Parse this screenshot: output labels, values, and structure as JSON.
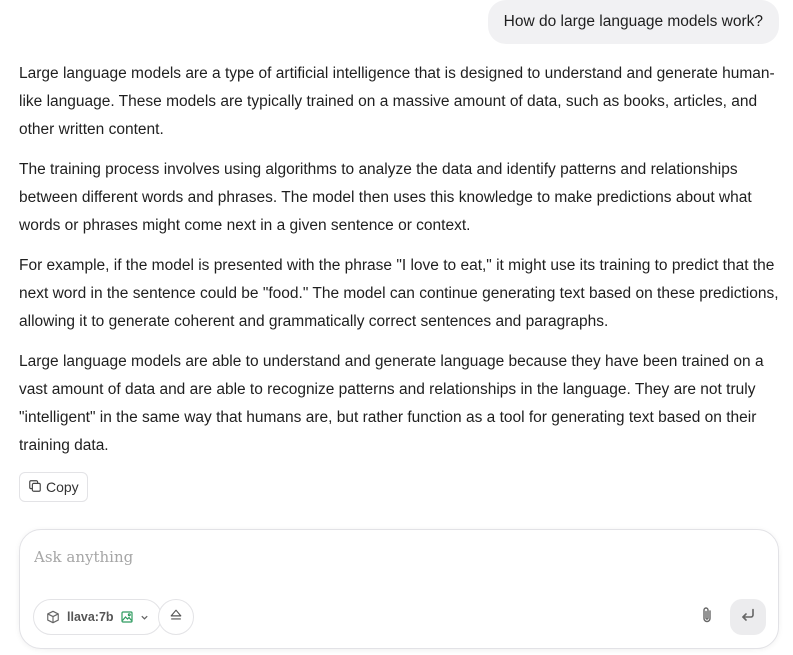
{
  "user_message": "How do large language models work?",
  "answer": {
    "paragraphs": [
      "Large language models are a type of artificial intelligence that is designed to understand and generate human-like language. These models are typically trained on a massive amount of data, such as books, articles, and other written content.",
      "The training process involves using algorithms to analyze the data and identify patterns and relationships between different words and phrases. The model then uses this knowledge to make predictions about what words or phrases might come next in a given sentence or context.",
      "For example, if the model is presented with the phrase \"I love to eat,\" it might use its training to predict that the next word in the sentence could be \"food.\" The model can continue generating text based on these predictions, allowing it to generate coherent and grammatically correct sentences and paragraphs.",
      "Large language models are able to understand and generate language because they have been trained on a vast amount of data and are able to recognize patterns and relationships in the language. They are not truly \"intelligent\" in the same way that humans are, but rather function as a tool for generating text based on their training data."
    ],
    "copy_label": "Copy"
  },
  "composer": {
    "placeholder": "Ask anything",
    "value": "",
    "model_name": "llava:7b"
  },
  "icons": {
    "copy": "copy-icon",
    "model": "cube-icon",
    "vision": "image-icon",
    "dropdown": "chevron-down-icon",
    "eject": "eject-icon",
    "attach": "paperclip-icon",
    "send": "enter-icon"
  },
  "colors": {
    "user_bubble_bg": "#f1f1f3",
    "vision_badge": "#2e9b5f",
    "send_bg": "#ececee"
  }
}
